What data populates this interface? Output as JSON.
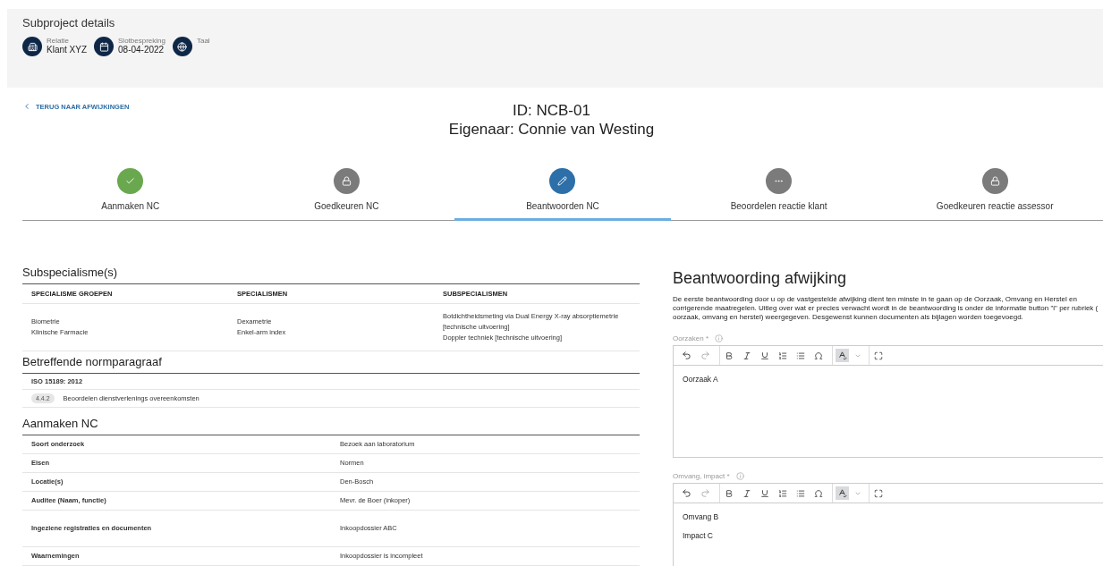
{
  "header": {
    "title": "Subproject details",
    "details": [
      {
        "kind": "building",
        "label": "Relatie",
        "value": "Klant XYZ"
      },
      {
        "kind": "calendar",
        "label": "Slotbespreking",
        "value": "08-04-2022"
      },
      {
        "kind": "globe",
        "label": "Taal"
      }
    ]
  },
  "back_link": "TERUG NAAR AFWIJKINGEN",
  "title_lines": [
    "ID: NCB-01",
    "Eigenaar: Connie van Westing"
  ],
  "steps": [
    {
      "label": "Aanmaken NC",
      "kind": "done",
      "selected": false
    },
    {
      "label": "Goedkeuren NC",
      "kind": "locked",
      "selected": false
    },
    {
      "label": "Beantwoorden NC",
      "kind": "active",
      "selected": true
    },
    {
      "label": "Beoordelen reactie klant",
      "kind": "pending",
      "selected": false
    },
    {
      "label": "Goedkeuren reactie assessor",
      "kind": "locked",
      "selected": false
    }
  ],
  "subspecialisms": {
    "title": "Subspecialisme(s)",
    "columns": [
      "SPECIALISME GROEPEN",
      "SPECIALISMEN",
      "SUBSPECIALISMEN"
    ],
    "cells": [
      [
        "Biometrie",
        "Klinische Farmacie"
      ],
      [
        "Dexametrie",
        "Enkel-arm index"
      ],
      [
        "Botdichtheidsmeting via Dual Energy X-ray absorptiemetrie [technische uitvoering]",
        "Doppler techniek [technische uitvoering]"
      ]
    ]
  },
  "norm": {
    "title": "Betreffende normparagraaf",
    "standard": "ISO 15189: 2012",
    "items": [
      {
        "code": "4.4.2",
        "text": "Beoordelen dienstverlenings overeenkomsten"
      }
    ]
  },
  "create_nc": {
    "title": "Aanmaken NC",
    "rows": [
      {
        "label": "Soort onderzoek",
        "value": "Bezoek aan laboratorium"
      },
      {
        "label": "Eisen",
        "value": "Normen"
      },
      {
        "label": "Locatie(s)",
        "value": "Den-Bosch"
      },
      {
        "label": "Auditee (Naam, functie)",
        "value": "Mevr. de Boer (inkoper)"
      },
      {
        "label": "Ingeziene registraties en documenten",
        "value": "Inkoopdossier ABC",
        "tall": true
      },
      {
        "label": "Waarnemingen",
        "value": "Inkoopdossier is incompleet"
      }
    ]
  },
  "response": {
    "title": "Beantwoording afwijking",
    "intro": "De eerste beantwoording door u op de vastgestelde afwijking dient ten minste in te gaan op de Oorzaak, Omvang en Herstel en corrigerende maatregelen. Uitleg over wat er precies verwacht wordt in de beantwoording is onder de informatie button \"i\" per rubriek ( oorzaak, omvang en herstel) weergegeven. Desgewenst kunnen documenten als bijlagen worden toegevoegd.",
    "editors": [
      {
        "label": "Oorzaken *",
        "paragraphs": [
          "Oorzaak A"
        ]
      },
      {
        "label": "Omvang, impact *",
        "paragraphs": [
          "Omvang B",
          "Impact C"
        ]
      }
    ]
  }
}
